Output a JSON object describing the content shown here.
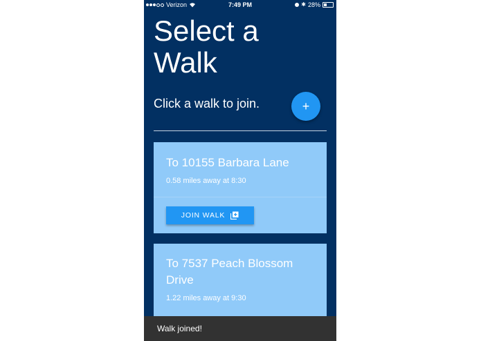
{
  "status_bar": {
    "carrier": "Verizon",
    "time": "7:49 PM",
    "battery": "28%"
  },
  "header": {
    "title_line1": "Select a",
    "title_line2": "Walk",
    "subtitle": "Click a walk to join.",
    "add_button_label": "+"
  },
  "walks": [
    {
      "destination_line1": "To 10155 Barbara Lane",
      "destination_line2": "",
      "detail": "0.58 miles away at 8:30",
      "action_label": "JOIN WALK"
    },
    {
      "destination_line1": "To 7537 Peach Blossom",
      "destination_line2": "Drive",
      "detail": "1.22 miles away at 9:30"
    }
  ],
  "snackbar": {
    "message": "Walk joined!"
  },
  "colors": {
    "background": "#023062",
    "card": "#90caf9",
    "accent": "#2196f3",
    "snackbar": "#323232"
  }
}
